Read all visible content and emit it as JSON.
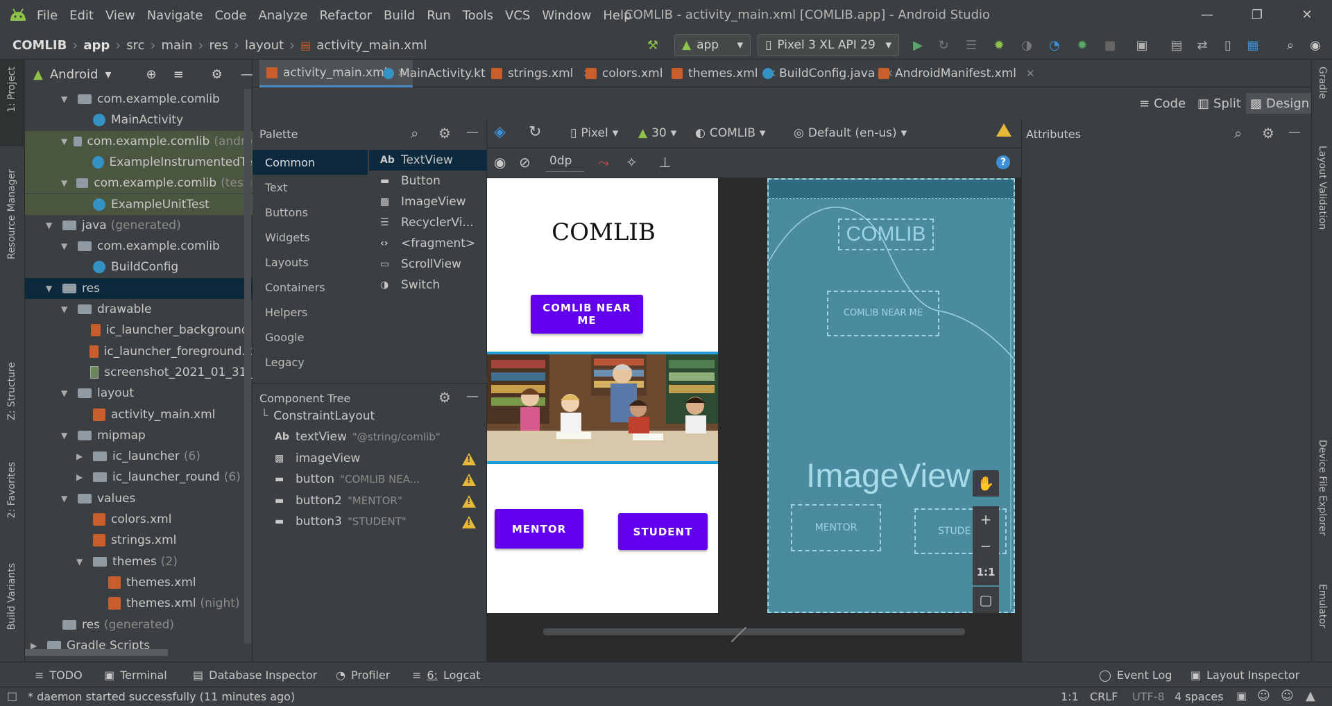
{
  "menubar": {
    "items": [
      "File",
      "Edit",
      "View",
      "Navigate",
      "Code",
      "Analyze",
      "Refactor",
      "Build",
      "Run",
      "Tools",
      "VCS",
      "Window",
      "Help"
    ],
    "window_title": "COMLIB - activity_main.xml [COMLIB.app] - Android Studio"
  },
  "navbar": {
    "crumbs": [
      "COMLIB",
      "app",
      "src",
      "main",
      "res",
      "layout",
      "activity_main.xml"
    ],
    "run_config": "app",
    "device": "Pixel 3 XL API 29"
  },
  "left_strip": {
    "project": "1: Project",
    "resource_manager": "Resource Manager",
    "structure": "Z: Structure",
    "favorites": "2: Favorites",
    "build_variants": "Build Variants"
  },
  "right_strip": {
    "gradle": "Gradle",
    "layout_validation": "Layout Validation",
    "device_file_explorer": "Device File Explorer",
    "emulator": "Emulator"
  },
  "project": {
    "view_mode": "Android",
    "tree": [
      {
        "label": "com.example.comlib",
        "extra": "",
        "indent": 1,
        "icon": "folder",
        "arrow": "down"
      },
      {
        "label": "MainActivity",
        "extra": "",
        "indent": 2,
        "icon": "class",
        "arrow": ""
      },
      {
        "label": "com.example.comlib",
        "extra": "(andro",
        "indent": 1,
        "icon": "folder",
        "arrow": "down"
      },
      {
        "label": "ExampleInstrumentedTe",
        "extra": "",
        "indent": 2,
        "icon": "class",
        "arrow": ""
      },
      {
        "label": "com.example.comlib",
        "extra": "(test)",
        "indent": 1,
        "icon": "folder",
        "arrow": "down"
      },
      {
        "label": "ExampleUnitTest",
        "extra": "",
        "indent": 2,
        "icon": "class",
        "arrow": ""
      },
      {
        "label": "java",
        "extra": "(generated)",
        "indent": 0,
        "icon": "folder",
        "arrow": "down"
      },
      {
        "label": "com.example.comlib",
        "extra": "",
        "indent": 1,
        "icon": "folder",
        "arrow": "down"
      },
      {
        "label": "BuildConfig",
        "extra": "",
        "indent": 2,
        "icon": "class",
        "arrow": ""
      },
      {
        "label": "res",
        "extra": "",
        "indent": 0,
        "icon": "folder",
        "arrow": "down"
      },
      {
        "label": "drawable",
        "extra": "",
        "indent": 1,
        "icon": "folder",
        "arrow": "down"
      },
      {
        "label": "ic_launcher_background.",
        "extra": "",
        "indent": 2,
        "icon": "xml",
        "arrow": ""
      },
      {
        "label": "ic_launcher_foreground.x",
        "extra": "",
        "indent": 2,
        "icon": "xml",
        "arrow": ""
      },
      {
        "label": "screenshot_2021_01_31_",
        "extra": "",
        "indent": 2,
        "icon": "img",
        "arrow": ""
      },
      {
        "label": "layout",
        "extra": "",
        "indent": 1,
        "icon": "folder",
        "arrow": "down"
      },
      {
        "label": "activity_main.xml",
        "extra": "",
        "indent": 2,
        "icon": "xml",
        "arrow": ""
      },
      {
        "label": "mipmap",
        "extra": "",
        "indent": 1,
        "icon": "folder",
        "arrow": "down"
      },
      {
        "label": "ic_launcher",
        "extra": "(6)",
        "indent": 2,
        "icon": "folder",
        "arrow": "right"
      },
      {
        "label": "ic_launcher_round",
        "extra": "(6)",
        "indent": 2,
        "icon": "folder",
        "arrow": "right"
      },
      {
        "label": "values",
        "extra": "",
        "indent": 1,
        "icon": "folder",
        "arrow": "down"
      },
      {
        "label": "colors.xml",
        "extra": "",
        "indent": 2,
        "icon": "xml",
        "arrow": ""
      },
      {
        "label": "strings.xml",
        "extra": "",
        "indent": 2,
        "icon": "xml",
        "arrow": ""
      },
      {
        "label": "themes",
        "extra": "(2)",
        "indent": 2,
        "icon": "folder",
        "arrow": "down"
      },
      {
        "label": "themes.xml",
        "extra": "",
        "indent": 3,
        "icon": "xml",
        "arrow": ""
      },
      {
        "label": "themes.xml",
        "extra": "(night)",
        "indent": 3,
        "icon": "xml",
        "arrow": ""
      },
      {
        "label": "res",
        "extra": "(generated)",
        "indent": 0,
        "icon": "folder",
        "arrow": ""
      },
      {
        "label": "Gradle Scripts",
        "extra": "",
        "indent": -1,
        "icon": "gradle",
        "arrow": "right"
      }
    ]
  },
  "editor_tabs": [
    "activity_main.xml",
    "MainActivity.kt",
    "strings.xml",
    "colors.xml",
    "themes.xml",
    "BuildConfig.java",
    "AndroidManifest.xml"
  ],
  "modes": {
    "code": "Code",
    "split": "Split",
    "design": "Design"
  },
  "palette": {
    "title": "Palette",
    "categories": [
      "Common",
      "Text",
      "Buttons",
      "Widgets",
      "Layouts",
      "Containers",
      "Helpers",
      "Google",
      "Legacy"
    ],
    "items": [
      "TextView",
      "Button",
      "ImageView",
      "RecyclerVi...",
      "<fragment>",
      "ScrollView",
      "Switch"
    ]
  },
  "design_toolbar": {
    "device": "Pixel",
    "api": "30",
    "theme": "COMLIB",
    "locale": "Default (en-us)",
    "margin": "0dp"
  },
  "component_tree": {
    "title": "Component Tree",
    "root": "ConstraintLayout",
    "items": [
      {
        "name": "textView",
        "value": "\"@string/comlib\"",
        "warn": false
      },
      {
        "name": "imageView",
        "value": "",
        "warn": true
      },
      {
        "name": "button",
        "value": "\"COMLIB NEA...",
        "warn": true
      },
      {
        "name": "button2",
        "value": "\"MENTOR\"",
        "warn": true
      },
      {
        "name": "button3",
        "value": "\"STUDENT\"",
        "warn": true
      }
    ]
  },
  "preview": {
    "title": "COMLIB",
    "near_me": "COMLIB NEAR ME",
    "mentor": "MENTOR",
    "student": "STUDENT",
    "primary_color": "#6200ee"
  },
  "blueprint": {
    "title": "COMLIB",
    "near_me": "COMLIB NEAR ME",
    "image_label": "ImageView",
    "mentor": "MENTOR",
    "student": "STUDE"
  },
  "zoom": {
    "one_to_one": "1:1"
  },
  "attributes": {
    "title": "Attributes"
  },
  "bottom_tabs": [
    {
      "label": "TODO",
      "num": ""
    },
    {
      "label": "Terminal",
      "num": ""
    },
    {
      "label": "Database Inspector",
      "num": ""
    },
    {
      "label": "Profiler",
      "num": ""
    },
    {
      "label": "Logcat",
      "num": "6:"
    }
  ],
  "bottom_right_tabs": [
    "Event Log",
    "Layout Inspector"
  ],
  "status": {
    "message": "* daemon started successfully (11 minutes ago)",
    "position": "1:1",
    "line_sep": "CRLF",
    "encoding": "UTF-8",
    "indent": "4 spaces"
  }
}
